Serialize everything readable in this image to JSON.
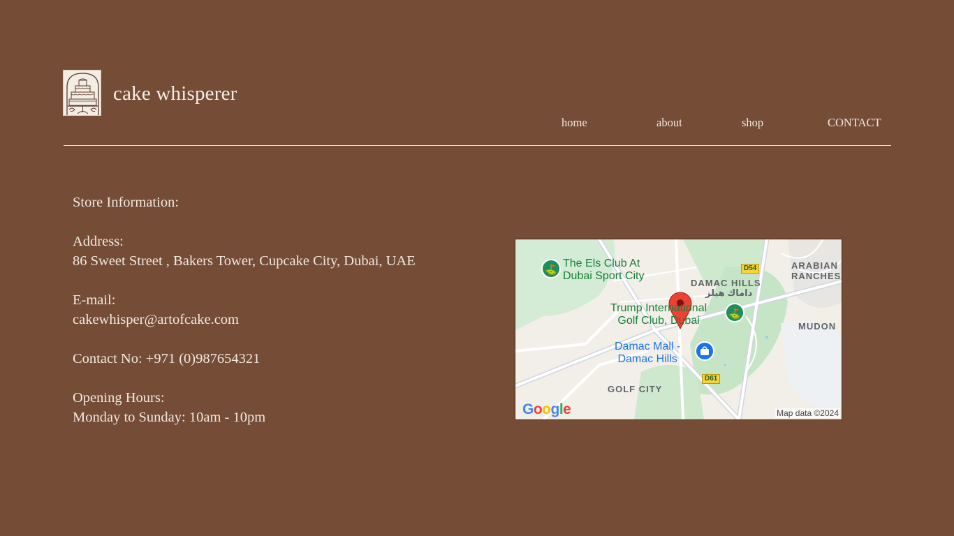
{
  "header": {
    "brand": "cake whisperer",
    "logo_icon": "tiered-cake-icon"
  },
  "nav": {
    "home": "home",
    "about": "about",
    "shop": "shop",
    "contact": "CONTACT"
  },
  "store": {
    "heading": "Store Information:",
    "address_label": "Address:",
    "address_value": "86 Sweet Street , Bakers Tower,  Cupcake City, Dubai, UAE",
    "email_label": "E-mail:",
    "email_value": "cakewhisper@artofcake.com",
    "contact": "Contact No: +971  (0)987654321",
    "hours_label": "Opening Hours:",
    "hours_value": "Monday to Sunday: 10am - 10pm"
  },
  "map": {
    "els_club": "The Els Club At\nDubai Sport City",
    "damac_hills": "DAMAC HILLS",
    "damac_hills_arabic": "داماك هيلز",
    "arabian_ranches": "ARABIAN\nRANCHES",
    "trump_golf": "Trump International\nGolf Club, Dubai",
    "mudon": "MUDON",
    "damac_mall": "Damac Mall -\nDamac Hills",
    "golf_city": "GOLF CITY",
    "road_d54": "D54",
    "road_d61": "D61",
    "google": "Google",
    "attribution": "Map data ©2024",
    "colors": {
      "land": "#f2efe9",
      "park": "#c8e6c9",
      "road": "#ffffff",
      "pin": "#ea4335"
    }
  },
  "colors": {
    "background": "#754c36",
    "text": "#f1e9df"
  }
}
